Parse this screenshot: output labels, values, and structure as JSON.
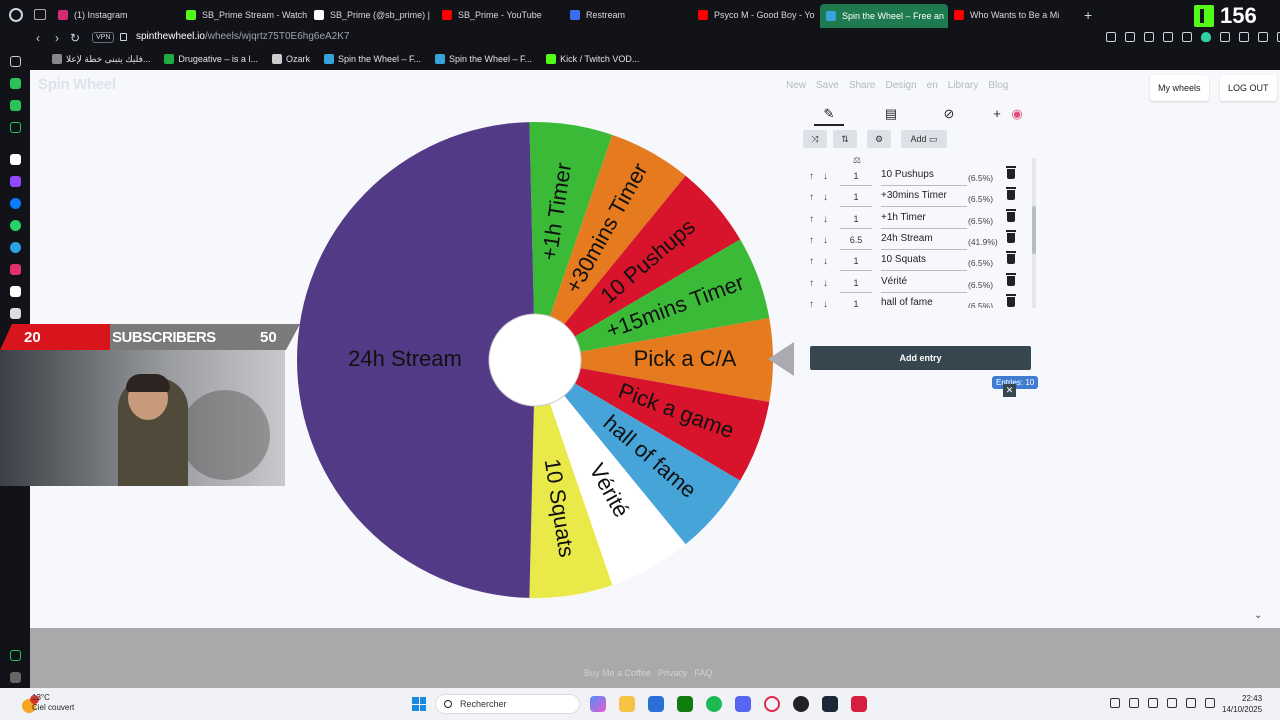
{
  "browser": {
    "tabs": [
      {
        "label": "(1) Instagram",
        "color": "#d62976"
      },
      {
        "label": "SB_Prime Stream - Watch",
        "color": "#53fc18"
      },
      {
        "label": "SB_Prime (@sb_prime) |",
        "color": "#ffffff"
      },
      {
        "label": "SB_Prime - YouTube",
        "color": "#ff0000"
      },
      {
        "label": "Restream",
        "color": "#3a6df0"
      },
      {
        "label": "Psyco M - Good Boy - Yo",
        "color": "#ff0000"
      },
      {
        "label": "Spin the Wheel – Free an",
        "color": "#36a3d9"
      },
      {
        "label": "Who Wants to Be a Mi",
        "color": "#ff0000"
      }
    ],
    "new_tab": "+",
    "kick_viewers": "156",
    "vpn": "VPN",
    "url_host": "spinthewheel.io",
    "url_path": "/wheels/wjqrtz75T0E6hg6eA2K7",
    "bookmarks": [
      {
        "label": "فليك يتبنى خطة لإعلا...",
        "color": "#888888"
      },
      {
        "label": "Drugeative – is a l...",
        "color": "#22aa44"
      },
      {
        "label": "Ozark",
        "color": "#cccccc"
      },
      {
        "label": "Spin the Wheel – F...",
        "color": "#36a3d9"
      },
      {
        "label": "Spin the Wheel – F...",
        "color": "#36a3d9"
      },
      {
        "label": "Kick / Twitch VOD...",
        "color": "#53fc18"
      }
    ]
  },
  "site": {
    "brand": "Spin Wheel",
    "nav": [
      "New",
      "Save",
      "Share",
      "Design",
      "en",
      "Library",
      "Blog"
    ],
    "my_wheels": "My wheels",
    "logout": "LOG OUT"
  },
  "wheel": {
    "segments": [
      {
        "label": "+1h Timer",
        "color": "#3aba37"
      },
      {
        "label": "+30mins Timer",
        "color": "#e57b1e"
      },
      {
        "label": "10 Pushups",
        "color": "#d7142b"
      },
      {
        "label": "+15mins Timer",
        "color": "#3aba37"
      },
      {
        "label": "Pick a C/A",
        "color": "#e57b1e"
      },
      {
        "label": "Pick a game",
        "color": "#d7142b"
      },
      {
        "label": "hall of fame",
        "color": "#47a4d9"
      },
      {
        "label": "Vérité",
        "color": "#ffffff"
      },
      {
        "label": "10 Squats",
        "color": "#e9e94a"
      },
      {
        "label": "24h Stream",
        "color": "#523a86"
      }
    ]
  },
  "panel": {
    "tool_add": "Add",
    "entries": [
      {
        "weight": "1",
        "label": "10 Pushups",
        "pct": "(6.5%)"
      },
      {
        "weight": "1",
        "label": "+30mins Timer",
        "pct": "(6.5%)"
      },
      {
        "weight": "1",
        "label": "+1h Timer",
        "pct": "(6.5%)"
      },
      {
        "weight": "6.5",
        "label": "24h Stream",
        "pct": "(41.9%)"
      },
      {
        "weight": "1",
        "label": "10 Squats",
        "pct": "(6.5%)"
      },
      {
        "weight": "1",
        "label": "Vérité",
        "pct": "(6.5%)"
      },
      {
        "weight": "1",
        "label": "hall of fame",
        "pct": "(6.5%)"
      }
    ],
    "add_entry": "Add entry",
    "entries_count": "Entries: 10"
  },
  "footer": {
    "links": [
      "Buy Me a Coffee",
      "Privacy",
      "FAQ"
    ]
  },
  "overlay": {
    "count_current": "20",
    "label": "SUBSCRIBERS",
    "count_goal": "50"
  },
  "taskbar": {
    "temp": "13°C",
    "weather": "Ciel couvert",
    "notif": "1",
    "search": "Rechercher",
    "time": "22:43",
    "date": "14/10/2025"
  }
}
